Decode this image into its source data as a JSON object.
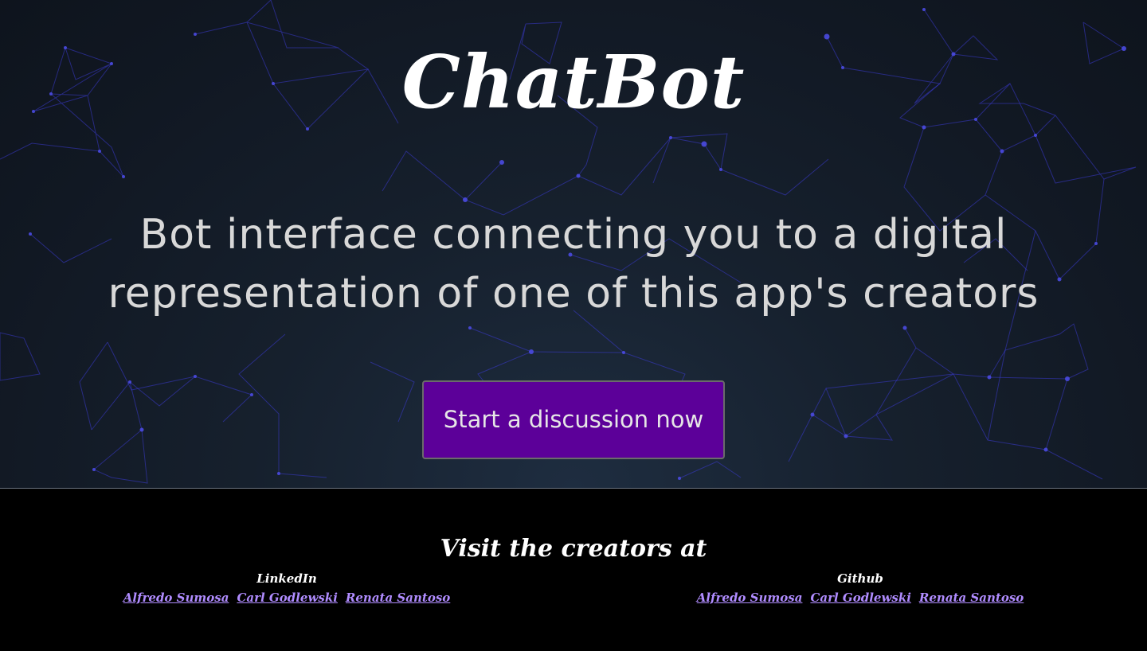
{
  "hero": {
    "title": "ChatBot",
    "tagline": "Bot interface connecting you to a digital representation of one of this app's creators",
    "cta_label": "Start a discussion now"
  },
  "footer": {
    "heading": "Visit the creators at",
    "linkedin": {
      "title": "LinkedIn",
      "links": [
        "Alfredo Sumosa",
        "Carl Godlewski",
        "Renata Santoso"
      ]
    },
    "github": {
      "title": "Github",
      "links": [
        "Alfredo Sumosa",
        "Carl Godlewski",
        "Renata Santoso"
      ]
    }
  },
  "colors": {
    "cta_background": "#5c0099",
    "link": "#b08cff",
    "network_lines": "#3a3ad0",
    "footer_background": "#000000"
  }
}
